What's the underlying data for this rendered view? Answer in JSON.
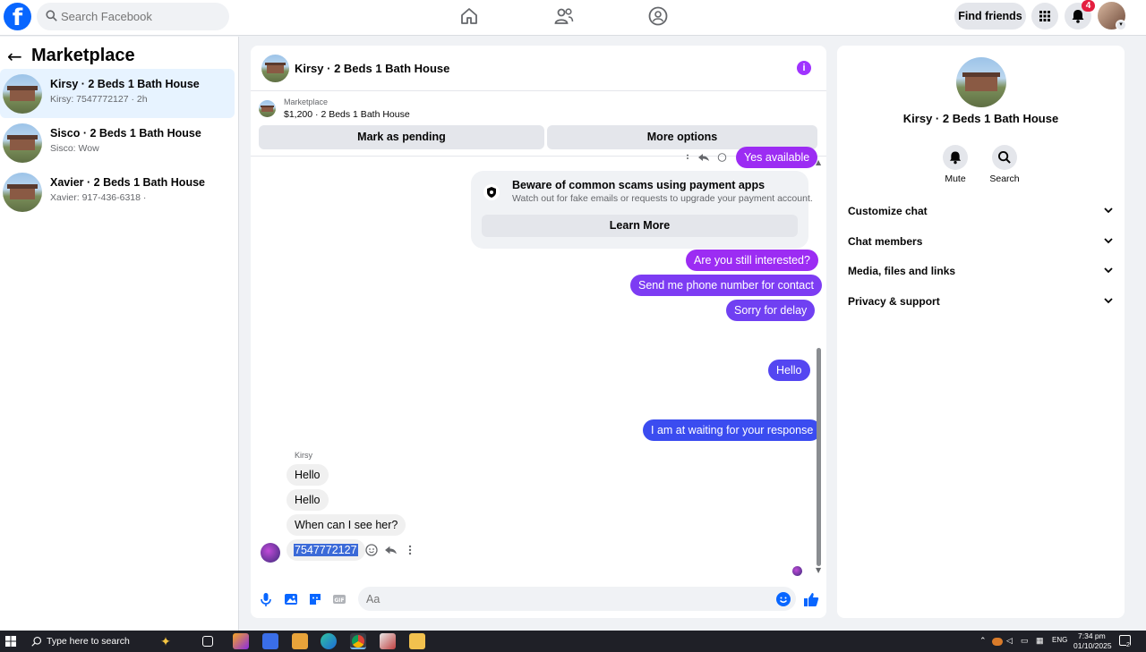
{
  "topbar": {
    "logo": "f",
    "search_placeholder": "Search Facebook",
    "find_friends": "Find friends",
    "notification_count": "4",
    "icons": [
      "home-icon",
      "friends-icon",
      "groups-icon",
      "menu-grid-icon",
      "bell-icon"
    ]
  },
  "sidebar": {
    "back_arrow": "←",
    "title": "Marketplace",
    "conversations": [
      {
        "name": "Kirsy · 2 Beds 1 Bath House",
        "preview": "Kirsy: 7547772127 · 2h",
        "active": true
      },
      {
        "name": "Sisco · 2 Beds 1 Bath House",
        "preview": "Sisco: Wow",
        "active": false
      },
      {
        "name": "Xavier · 2 Beds 1 Bath House",
        "preview": "Xavier: 917-436-6318 ·",
        "active": false
      }
    ]
  },
  "chat": {
    "title": "Kirsy · 2 Beds 1 Bath House",
    "info_icon": "i",
    "listing": {
      "source": "Marketplace",
      "price_title": "$1,200 · 2 Beds 1 Bath House",
      "mark_pending": "Mark as pending",
      "more_options": "More options"
    },
    "partial_top_bubble": "Yes available",
    "scam_notice": {
      "title": "Beware of common scams using payment apps",
      "text": "Watch out for fake emails or requests to upgrade your payment account.",
      "button": "Learn More"
    },
    "outgoing": [
      "Are you still interested?",
      "Send me phone number for contact",
      "Sorry for delay",
      "Hello",
      "I am at waiting for your response"
    ],
    "sender_label": "Kirsy",
    "incoming": [
      "Hello",
      "Hello",
      "When can I see her?",
      "7547772127"
    ],
    "composer_placeholder": "Aa",
    "colors": {
      "purple": "#9c2cf3",
      "blue": "#3b4cf0",
      "accent": "#0866ff"
    }
  },
  "right_panel": {
    "title": "Kirsy · 2 Beds 1 Bath House",
    "actions": [
      {
        "label": "Mute",
        "icon": "bell-icon"
      },
      {
        "label": "Search",
        "icon": "search-icon"
      }
    ],
    "sections": [
      "Customize chat",
      "Chat members",
      "Media, files and links",
      "Privacy & support"
    ]
  },
  "taskbar": {
    "search_text": "Type here to search",
    "lang": "ENG",
    "time": "7:34 pm",
    "date": "01/10/2025",
    "notif_count": "2"
  }
}
